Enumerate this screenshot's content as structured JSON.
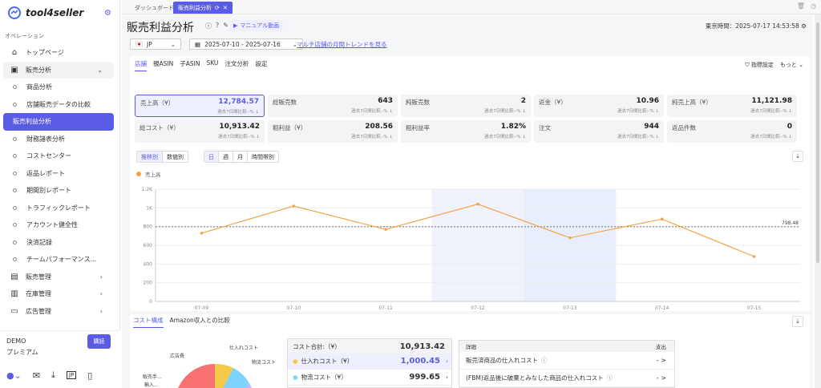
{
  "app": {
    "name": "tool4seller"
  },
  "sidebar": {
    "section": "オペレーション",
    "items": [
      {
        "label": "トップページ",
        "icon": "home-icon",
        "type": "top"
      },
      {
        "label": "販売分析",
        "icon": "chart-icon",
        "type": "group",
        "chev": "⌄"
      },
      {
        "label": "商品分析",
        "type": "sub"
      },
      {
        "label": "店舗販売データの比較",
        "type": "sub"
      },
      {
        "label": "販売利益分析",
        "type": "active"
      },
      {
        "label": "財務諸表分析",
        "type": "sub"
      },
      {
        "label": "コストセンター",
        "type": "sub"
      },
      {
        "label": "返品レポート",
        "type": "sub"
      },
      {
        "label": "期間別レポート",
        "type": "sub"
      },
      {
        "label": "トラフィックレポート",
        "type": "sub"
      },
      {
        "label": "アカウント健全性",
        "type": "sub"
      },
      {
        "label": "決済記録",
        "type": "sub"
      },
      {
        "label": "チームパフォーマンス...",
        "type": "sub"
      },
      {
        "label": "販売管理",
        "icon": "store-icon",
        "type": "top",
        "chev": "›"
      },
      {
        "label": "在庫管理",
        "icon": "box-icon",
        "type": "top",
        "chev": "›"
      },
      {
        "label": "広告管理",
        "icon": "monitor-icon",
        "type": "top",
        "chev": "›"
      }
    ],
    "plan": {
      "line1": "DEMO",
      "line2": "プレミアム",
      "buy": "購読"
    }
  },
  "tabs": {
    "dashboard": "ダッシュボード",
    "current": "販売利益分析"
  },
  "header": {
    "title": "販売利益分析",
    "manual": "マニュアル動画",
    "clock": "東京時間：2025-07-17 14:53:58",
    "marketplace": "JP",
    "date_range": "2025-07-10 - 2025-07-16",
    "trend_link": "マルチ店舗の月間トレンドを見る"
  },
  "subtabs": [
    "店舗",
    "親ASIN",
    "子ASIN",
    "SKU",
    "注文分析",
    "設定"
  ],
  "metric_settings": {
    "label": "指標設定",
    "more": "もっと"
  },
  "metrics": [
    {
      "name": "売上高（¥）",
      "value": "12,784.57",
      "cmp": "過去7日間比較:-% ↓"
    },
    {
      "name": "総販売数",
      "value": "643",
      "cmp": "過去7日間比較:-% ↓"
    },
    {
      "name": "純販売数",
      "value": "2",
      "cmp": "過去7日間比較:-% ↓"
    },
    {
      "name": "返金（¥）",
      "value": "10.96",
      "cmp": "過去7日間比較:-% ↓"
    },
    {
      "name": "純売上高（¥）",
      "value": "11,121.98",
      "cmp": "過去7日間比較:-% ↓"
    },
    {
      "name": "総コスト（¥）",
      "value": "10,913.42",
      "cmp": "過去7日間比較:-% ↓"
    },
    {
      "name": "粗利益（¥）",
      "value": "208.56",
      "cmp": "過去7日間比較:-% ↓"
    },
    {
      "name": "粗利益率",
      "value": "1.82%",
      "cmp": "過去7日間比較:-% ↓"
    },
    {
      "name": "注文",
      "value": "944",
      "cmp": "過去7日間比較:-% ↓"
    },
    {
      "name": "返品件数",
      "value": "0",
      "cmp": "過去7日間比較:-% ↓"
    }
  ],
  "view_buttons": [
    "推移別",
    "数値別"
  ],
  "period_buttons": [
    "日",
    "週",
    "月",
    "時間帯別"
  ],
  "chart_data": {
    "type": "line",
    "series": [
      {
        "name": "売上高",
        "color": "#f5a34b",
        "values": [
          730,
          1020,
          770,
          1040,
          680,
          880,
          480
        ]
      }
    ],
    "categories": [
      "07-09",
      "07-10",
      "07-11",
      "07-12",
      "07-13",
      "07-14",
      "07-15"
    ],
    "yticks": [
      "0",
      "200",
      "400",
      "600",
      "800",
      "1K",
      "1.2K"
    ],
    "ylim": [
      0,
      1200
    ],
    "average": 798.48,
    "average_label": "798.48"
  },
  "cost": {
    "tabs": [
      "コスト構成",
      "Amazon収入との比較"
    ],
    "total_label": "コスト合計:（¥）",
    "total_value": "10,913.42",
    "rows": [
      {
        "label": "仕入れコスト（¥）",
        "value": "1,000.45"
      },
      {
        "label": "物流コスト（¥）",
        "value": "999.65"
      }
    ],
    "pie_labels": [
      "広告費",
      "仕入れコスト",
      "物流コスト",
      "販売手...",
      "輸入..."
    ],
    "detail": {
      "h1": "詳細",
      "h2": "支出",
      "rows": [
        {
          "label": "販売済商品の仕入れコスト",
          "value": "- >"
        },
        {
          "label": "(FBM)返品後に破棄とみなした商品の仕入れコスト",
          "value": "- >"
        }
      ]
    }
  }
}
